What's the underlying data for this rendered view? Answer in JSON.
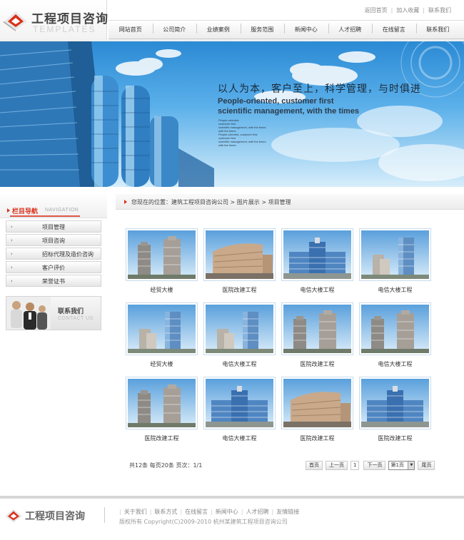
{
  "header": {
    "logo_cn": "工程项目咨询",
    "logo_en": "TEMPLATES",
    "top_links": [
      "返回首页",
      "加入收藏",
      "联系我们"
    ],
    "nav": [
      "网站首页",
      "公司简介",
      "业绩案例",
      "服务范围",
      "新闻中心",
      "人才招聘",
      "在线留言",
      "联系我们"
    ]
  },
  "banner": {
    "slogan_cn": "以人为本，客户至上，科学管理，与时俱进",
    "slogan_en_1": "People-oriented, customer first",
    "slogan_en_2": "scientific management, with the times",
    "small_lines": [
      "People-oriented,",
      "customer first",
      "scientific management, with the times",
      "with the times",
      "People-oriented, customer first",
      "customer first",
      "scientific management, with the times",
      "with the times"
    ]
  },
  "sidebar": {
    "title_cn": "栏目导航",
    "title_en": "NAVIGATION",
    "items": [
      "项目管理",
      "项目咨询",
      "招标代理及造价咨询",
      "客户评价",
      "荣誉证书"
    ],
    "contact_cn": "联系我们",
    "contact_en": "CONTACT US"
  },
  "breadcrumb": "您现在的位置：建筑工程项目咨询公司  >  图片展示  >  项目管理",
  "gallery": [
    {
      "caption": "经贸大楼",
      "style": "twin"
    },
    {
      "caption": "医院改建工程",
      "style": "curved"
    },
    {
      "caption": "电信大楼工程",
      "style": "wide"
    },
    {
      "caption": "电信大楼工程",
      "style": "tower"
    },
    {
      "caption": "经贸大楼",
      "style": "tower"
    },
    {
      "caption": "电信大楼工程",
      "style": "tower"
    },
    {
      "caption": "医院改建工程",
      "style": "twin"
    },
    {
      "caption": "电信大楼工程",
      "style": "twin"
    },
    {
      "caption": "医院改建工程",
      "style": "twin"
    },
    {
      "caption": "电信大楼工程",
      "style": "wide"
    },
    {
      "caption": "医院改建工程",
      "style": "curved"
    },
    {
      "caption": "医院改建工程",
      "style": "wide"
    }
  ],
  "pagination": {
    "info": "共12条  每页20条  页次：1/1",
    "first": "首页",
    "prev": "上一页",
    "current": "1",
    "next": "下一页",
    "select": "第1页",
    "last": "尾页"
  },
  "footer": {
    "logo": "工程项目咨询",
    "links": [
      "关于我们",
      "联系方式",
      "在线留言",
      "新闻中心",
      "人才招聘",
      "友情链接"
    ],
    "copyright": "版权所有 Copyright(C)2009-2010 杭州某建筑工程项目咨询公司"
  },
  "colors": {
    "accent": "#d9301a",
    "thumb_border": "#c8dced",
    "banner_sky": "#5bb0ea"
  }
}
